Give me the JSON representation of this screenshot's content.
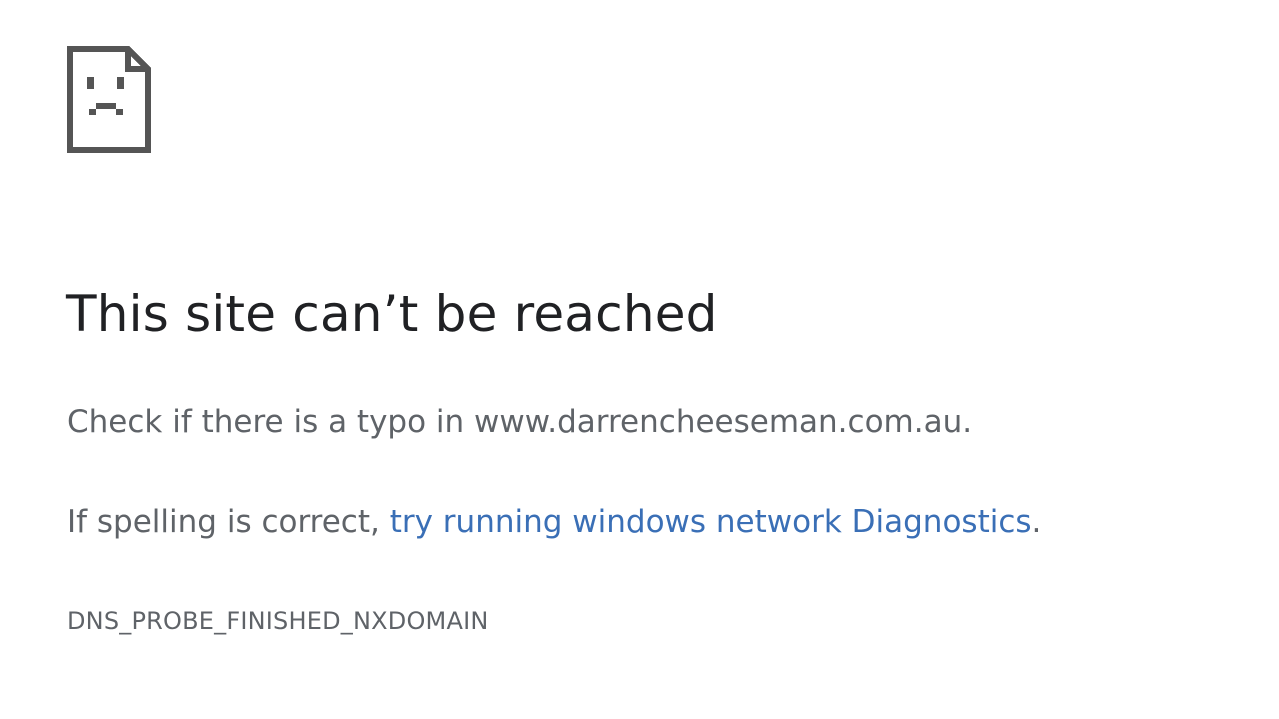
{
  "error_page": {
    "icon": "sad-page-icon",
    "title": "This site can’t be reached",
    "check_text": "Check if there is a typo in www.darrencheeseman.com.au.",
    "spelling_prefix": "If spelling is correct, ",
    "diagnostics_link": "try running windows network Diagnostics",
    "spelling_suffix": ".",
    "error_code": "DNS_PROBE_FINISHED_NXDOMAIN"
  },
  "colors": {
    "background": "#ffffff",
    "title": "#202124",
    "body_text": "#5f6368",
    "link": "#3a6fb6",
    "icon": "#555555"
  }
}
